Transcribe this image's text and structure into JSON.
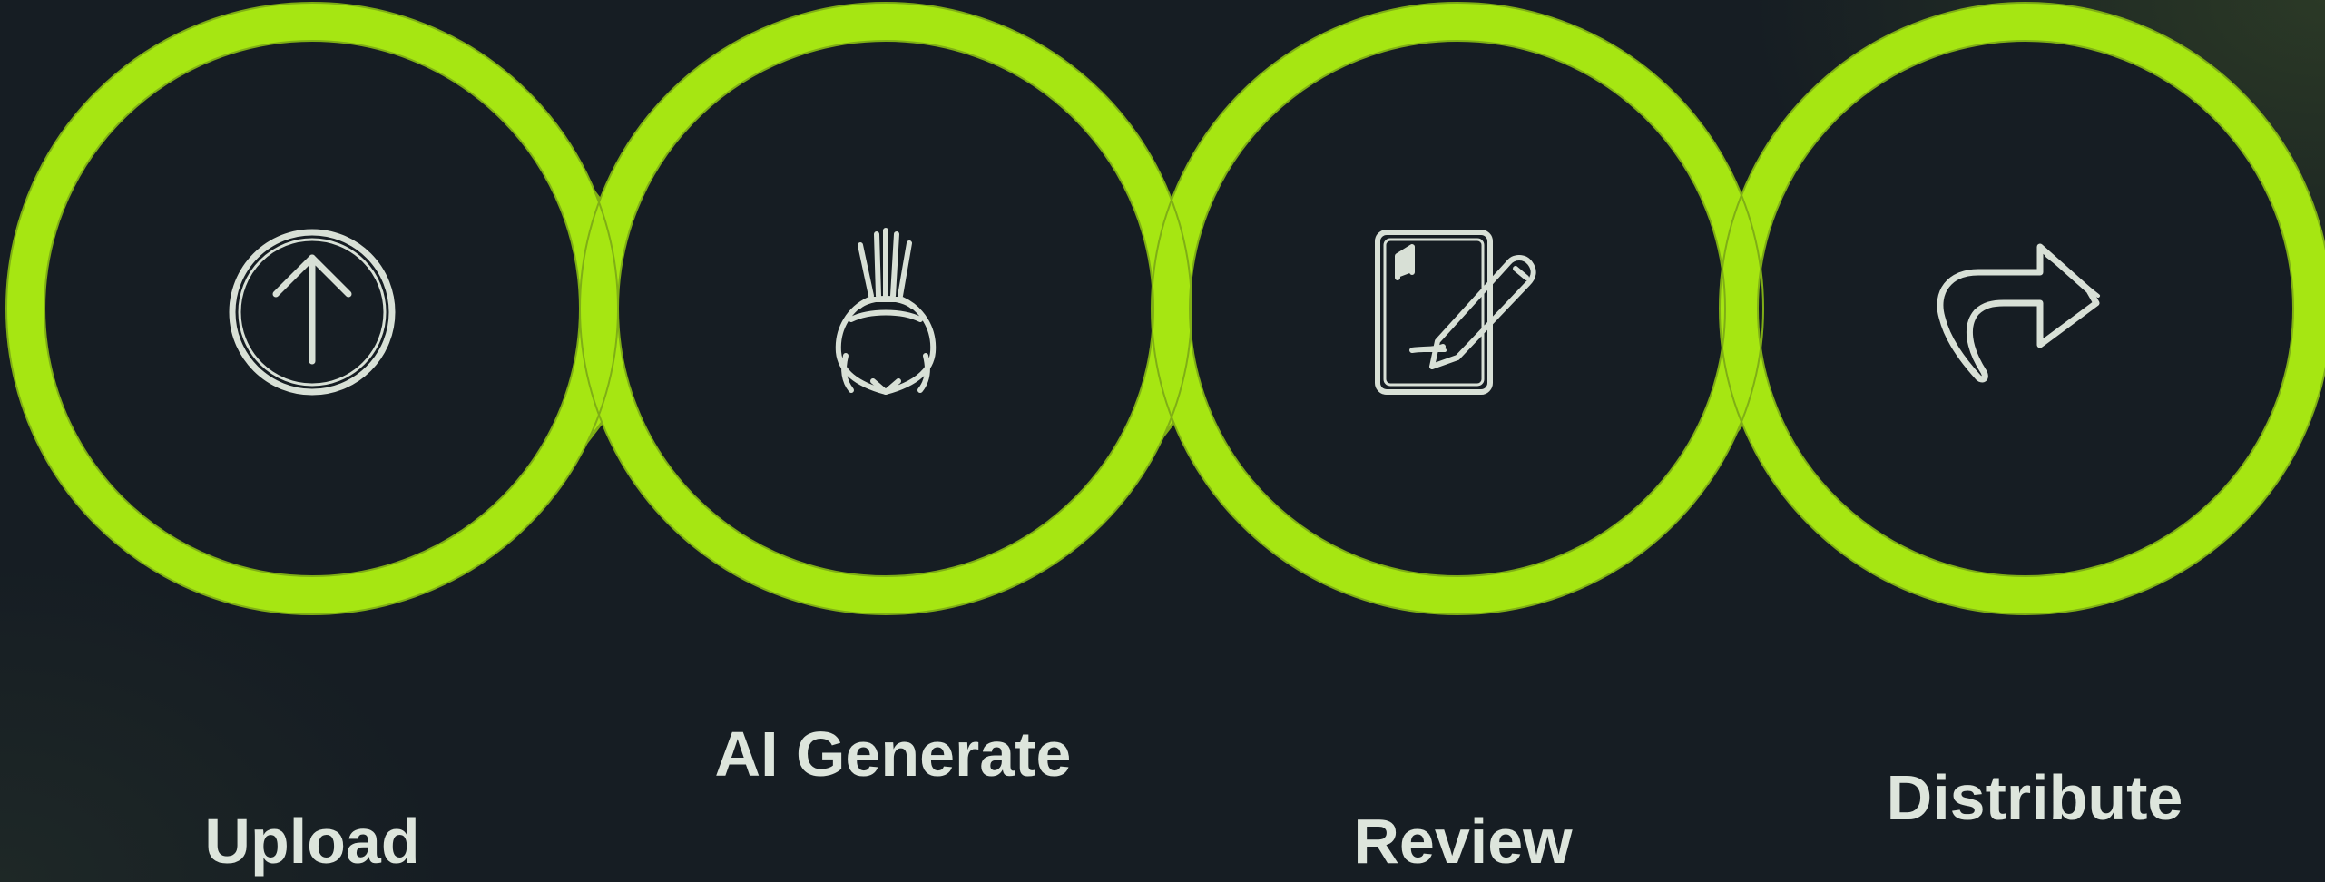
{
  "colors": {
    "background": "#161d23",
    "ring": "#a6e612",
    "ring_edge": "#7fae16",
    "icon": "#d8e0d6",
    "label": "#dde5dc"
  },
  "steps": [
    {
      "label": "Upload",
      "icon": "arrow-up-circle-icon"
    },
    {
      "label": "AI Generate",
      "icon": "brain-sparkle-icon"
    },
    {
      "label": "Review",
      "icon": "document-pen-icon"
    },
    {
      "label": "Distribute",
      "icon": "share-arrow-icon"
    }
  ]
}
